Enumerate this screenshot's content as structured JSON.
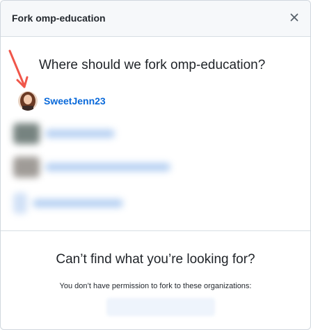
{
  "dialog": {
    "title": "Fork omp-education",
    "close_icon": "close-icon"
  },
  "fork_target": {
    "question": "Where should we fork omp-education?",
    "user": {
      "name": "SweetJenn23",
      "avatar_icon": "avatar"
    },
    "blurred_items": 3
  },
  "footer": {
    "heading": "Can’t find what you’re looking for?",
    "permission_text": "You don’t have permission to fork to these organizations:"
  },
  "colors": {
    "link": "#0969da",
    "header_bg": "#f6f8fa",
    "arrow": "#f0564a"
  }
}
